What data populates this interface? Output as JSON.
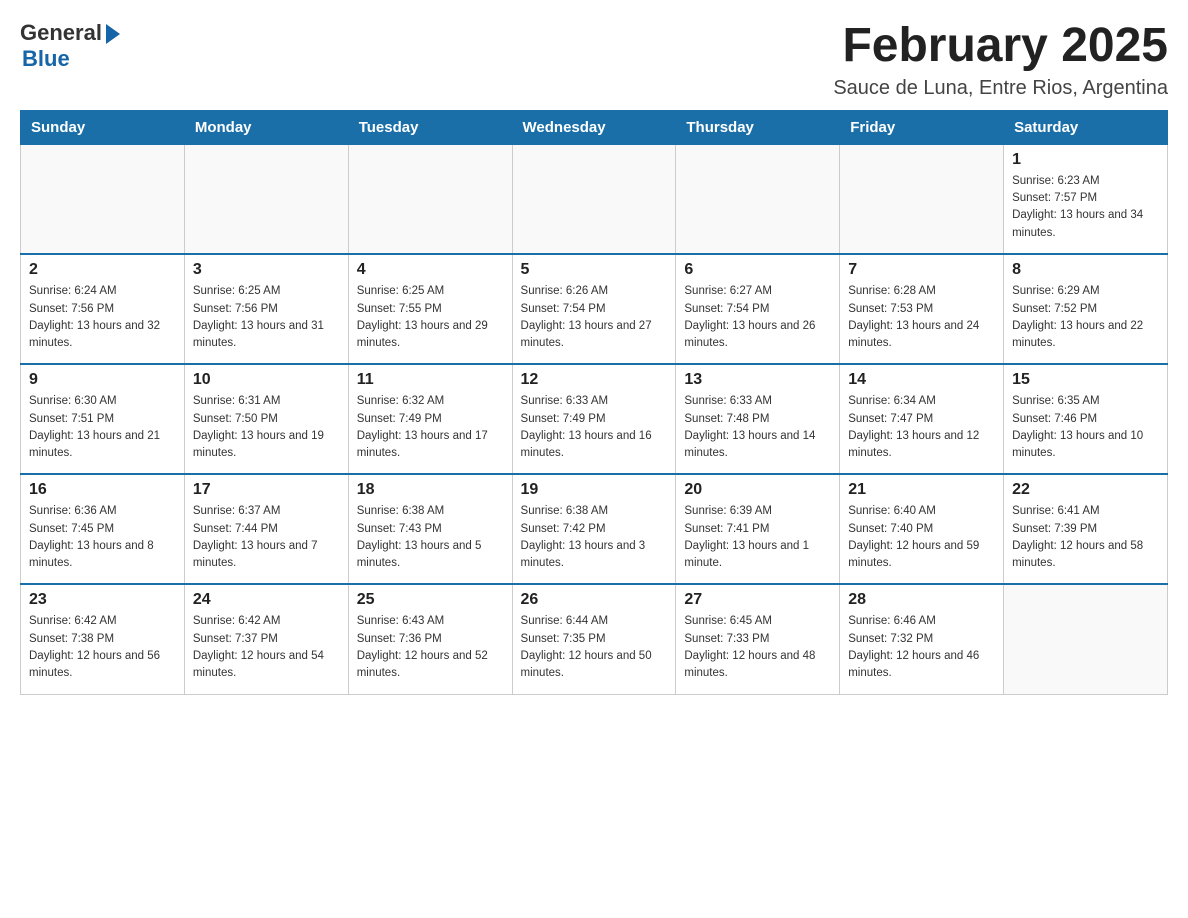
{
  "logo": {
    "general": "General",
    "blue": "Blue"
  },
  "header": {
    "month_year": "February 2025",
    "location": "Sauce de Luna, Entre Rios, Argentina"
  },
  "days_of_week": [
    "Sunday",
    "Monday",
    "Tuesday",
    "Wednesday",
    "Thursday",
    "Friday",
    "Saturday"
  ],
  "weeks": [
    [
      {
        "day": "",
        "info": ""
      },
      {
        "day": "",
        "info": ""
      },
      {
        "day": "",
        "info": ""
      },
      {
        "day": "",
        "info": ""
      },
      {
        "day": "",
        "info": ""
      },
      {
        "day": "",
        "info": ""
      },
      {
        "day": "1",
        "info": "Sunrise: 6:23 AM\nSunset: 7:57 PM\nDaylight: 13 hours and 34 minutes."
      }
    ],
    [
      {
        "day": "2",
        "info": "Sunrise: 6:24 AM\nSunset: 7:56 PM\nDaylight: 13 hours and 32 minutes."
      },
      {
        "day": "3",
        "info": "Sunrise: 6:25 AM\nSunset: 7:56 PM\nDaylight: 13 hours and 31 minutes."
      },
      {
        "day": "4",
        "info": "Sunrise: 6:25 AM\nSunset: 7:55 PM\nDaylight: 13 hours and 29 minutes."
      },
      {
        "day": "5",
        "info": "Sunrise: 6:26 AM\nSunset: 7:54 PM\nDaylight: 13 hours and 27 minutes."
      },
      {
        "day": "6",
        "info": "Sunrise: 6:27 AM\nSunset: 7:54 PM\nDaylight: 13 hours and 26 minutes."
      },
      {
        "day": "7",
        "info": "Sunrise: 6:28 AM\nSunset: 7:53 PM\nDaylight: 13 hours and 24 minutes."
      },
      {
        "day": "8",
        "info": "Sunrise: 6:29 AM\nSunset: 7:52 PM\nDaylight: 13 hours and 22 minutes."
      }
    ],
    [
      {
        "day": "9",
        "info": "Sunrise: 6:30 AM\nSunset: 7:51 PM\nDaylight: 13 hours and 21 minutes."
      },
      {
        "day": "10",
        "info": "Sunrise: 6:31 AM\nSunset: 7:50 PM\nDaylight: 13 hours and 19 minutes."
      },
      {
        "day": "11",
        "info": "Sunrise: 6:32 AM\nSunset: 7:49 PM\nDaylight: 13 hours and 17 minutes."
      },
      {
        "day": "12",
        "info": "Sunrise: 6:33 AM\nSunset: 7:49 PM\nDaylight: 13 hours and 16 minutes."
      },
      {
        "day": "13",
        "info": "Sunrise: 6:33 AM\nSunset: 7:48 PM\nDaylight: 13 hours and 14 minutes."
      },
      {
        "day": "14",
        "info": "Sunrise: 6:34 AM\nSunset: 7:47 PM\nDaylight: 13 hours and 12 minutes."
      },
      {
        "day": "15",
        "info": "Sunrise: 6:35 AM\nSunset: 7:46 PM\nDaylight: 13 hours and 10 minutes."
      }
    ],
    [
      {
        "day": "16",
        "info": "Sunrise: 6:36 AM\nSunset: 7:45 PM\nDaylight: 13 hours and 8 minutes."
      },
      {
        "day": "17",
        "info": "Sunrise: 6:37 AM\nSunset: 7:44 PM\nDaylight: 13 hours and 7 minutes."
      },
      {
        "day": "18",
        "info": "Sunrise: 6:38 AM\nSunset: 7:43 PM\nDaylight: 13 hours and 5 minutes."
      },
      {
        "day": "19",
        "info": "Sunrise: 6:38 AM\nSunset: 7:42 PM\nDaylight: 13 hours and 3 minutes."
      },
      {
        "day": "20",
        "info": "Sunrise: 6:39 AM\nSunset: 7:41 PM\nDaylight: 13 hours and 1 minute."
      },
      {
        "day": "21",
        "info": "Sunrise: 6:40 AM\nSunset: 7:40 PM\nDaylight: 12 hours and 59 minutes."
      },
      {
        "day": "22",
        "info": "Sunrise: 6:41 AM\nSunset: 7:39 PM\nDaylight: 12 hours and 58 minutes."
      }
    ],
    [
      {
        "day": "23",
        "info": "Sunrise: 6:42 AM\nSunset: 7:38 PM\nDaylight: 12 hours and 56 minutes."
      },
      {
        "day": "24",
        "info": "Sunrise: 6:42 AM\nSunset: 7:37 PM\nDaylight: 12 hours and 54 minutes."
      },
      {
        "day": "25",
        "info": "Sunrise: 6:43 AM\nSunset: 7:36 PM\nDaylight: 12 hours and 52 minutes."
      },
      {
        "day": "26",
        "info": "Sunrise: 6:44 AM\nSunset: 7:35 PM\nDaylight: 12 hours and 50 minutes."
      },
      {
        "day": "27",
        "info": "Sunrise: 6:45 AM\nSunset: 7:33 PM\nDaylight: 12 hours and 48 minutes."
      },
      {
        "day": "28",
        "info": "Sunrise: 6:46 AM\nSunset: 7:32 PM\nDaylight: 12 hours and 46 minutes."
      },
      {
        "day": "",
        "info": ""
      }
    ]
  ]
}
